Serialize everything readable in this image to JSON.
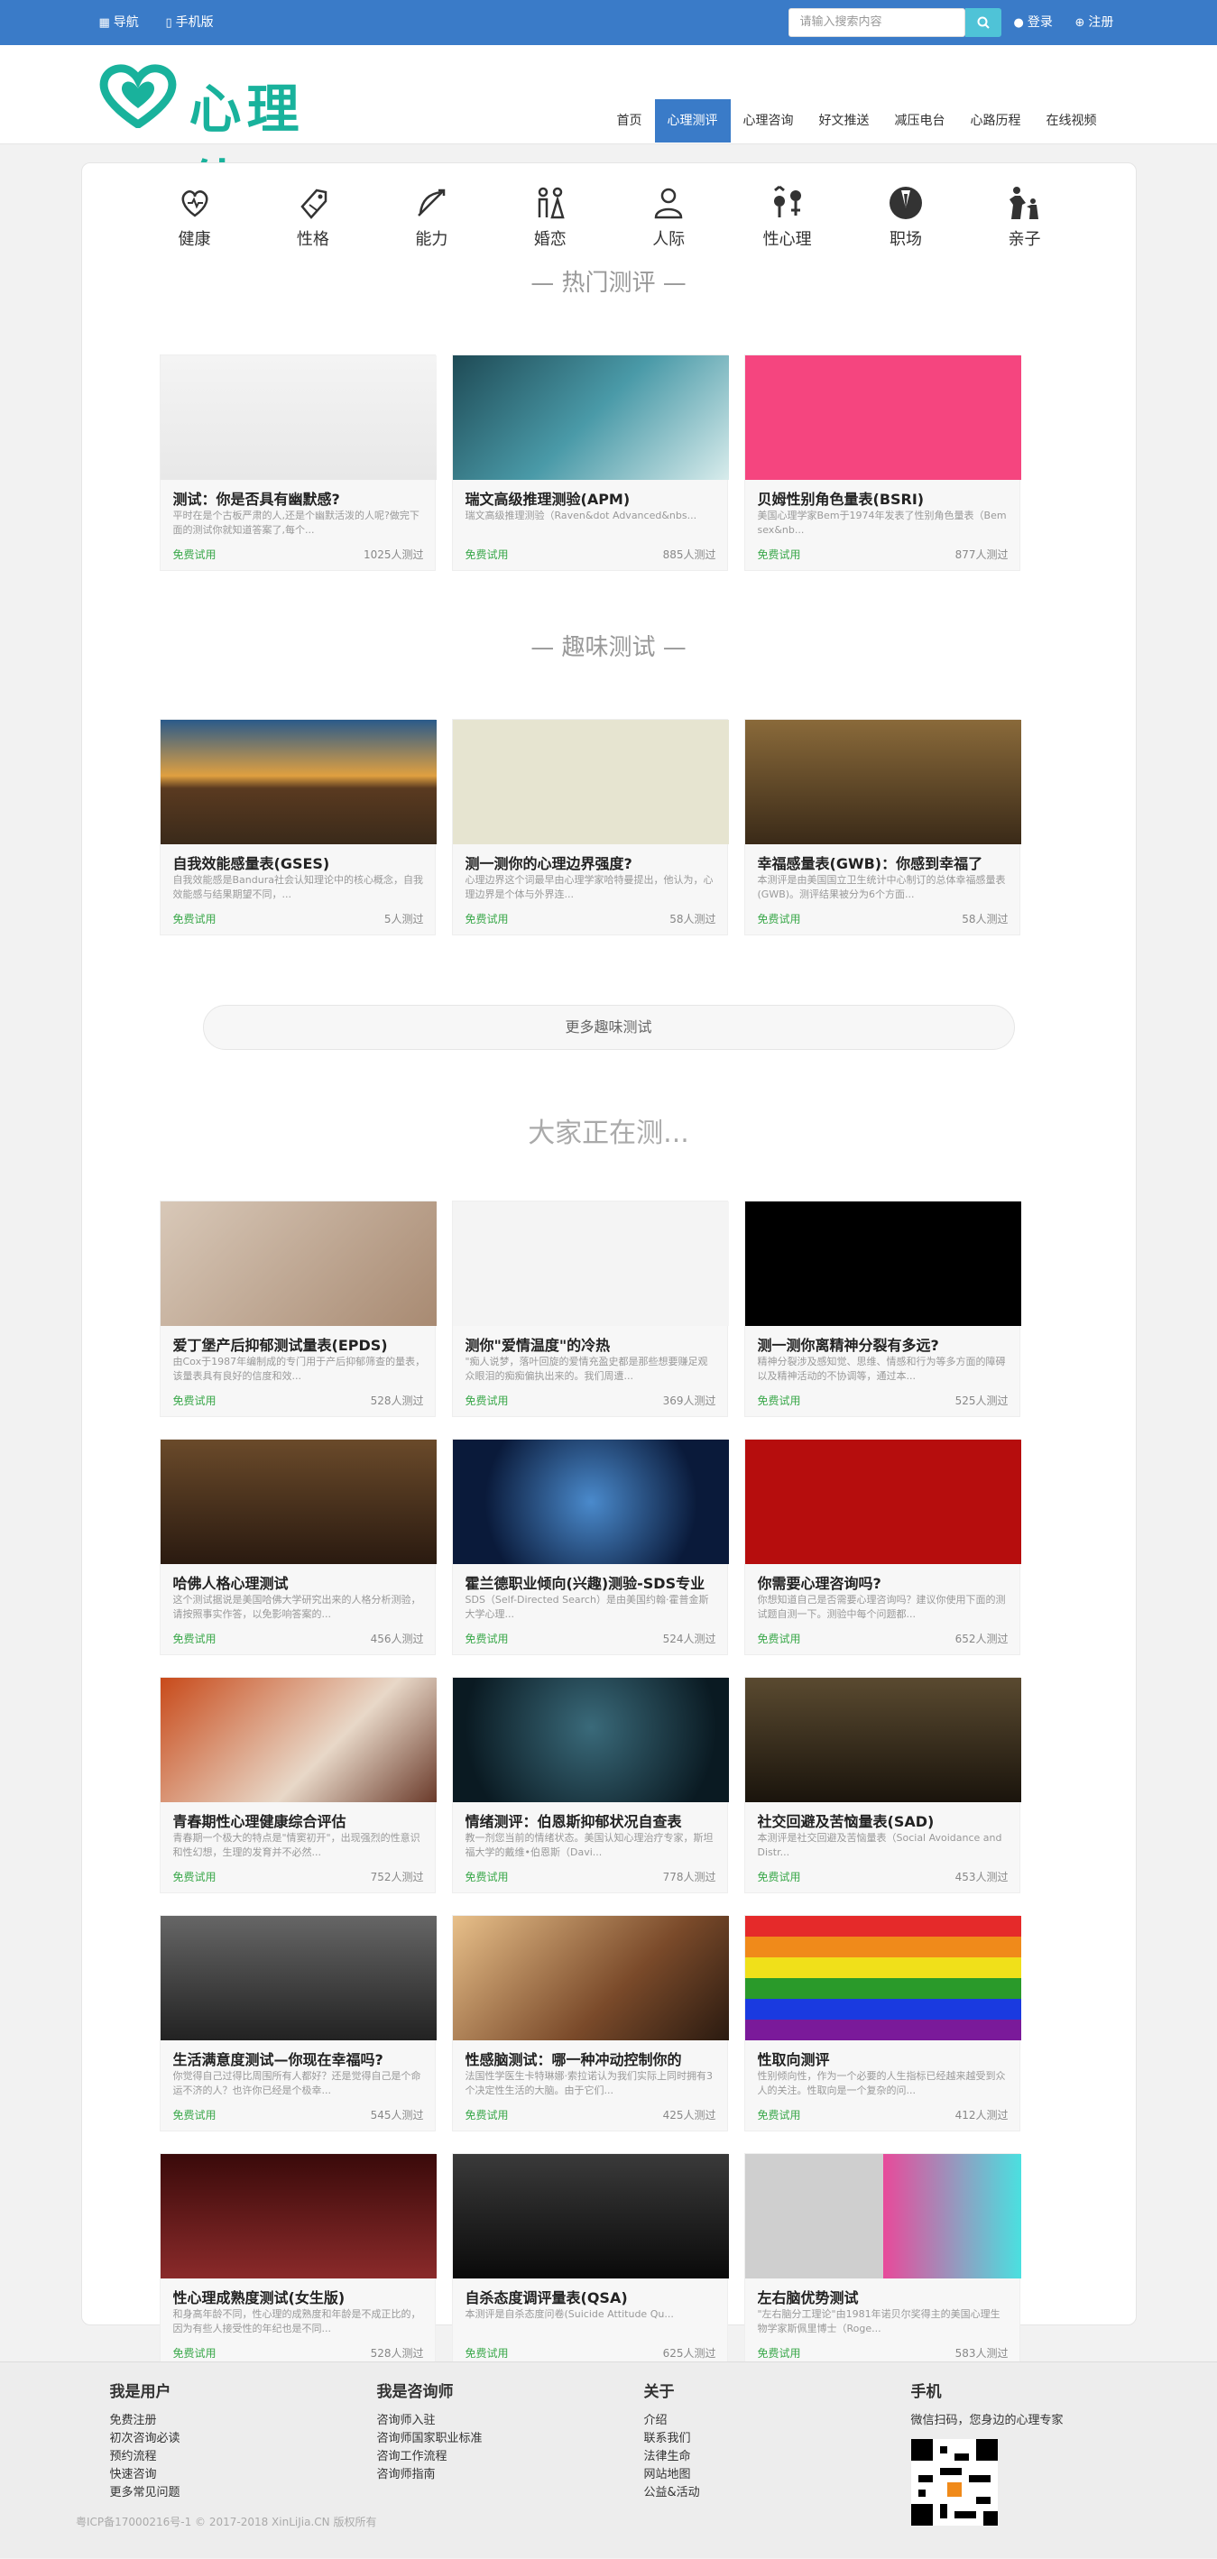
{
  "topbar": {
    "nav_label": "导航",
    "mobile_label": "手机版",
    "search_placeholder": "请输入搜索内容",
    "login_label": "登录",
    "register_label": "注册"
  },
  "header": {
    "logo_text": "心理佳",
    "nav": [
      "首页",
      "心理测评",
      "心理咨询",
      "好文推送",
      "减压电台",
      "心路历程",
      "在线视频"
    ],
    "active_nav": 1
  },
  "categories": [
    "健康",
    "性格",
    "能力",
    "婚恋",
    "人际",
    "性心理",
    "职场",
    "亲子"
  ],
  "hot": {
    "title": "— 热门测评 —",
    "cards": [
      {
        "title": "测试：你是否具有幽默感?",
        "desc": "平时在是个古板严肃的人,还是个幽默活泼的人呢?做完下面的测试你就知道答案了,每个...",
        "free": "免费试用",
        "count": "1025人测过"
      },
      {
        "title": "瑞文高级推理测验(APM)",
        "desc": "瑞文高级推理测验（Raven&dot Advanced&nbs...",
        "free": "免费试用",
        "count": "885人测过"
      },
      {
        "title": "贝姆性别角色量表(BSRI)",
        "desc": "美国心理学家Bem于1974年发表了性别角色量表（Bem sex&nb...",
        "free": "免费试用",
        "count": "877人测过"
      }
    ]
  },
  "fun": {
    "title": "— 趣味测试 —",
    "cards": [
      {
        "title": "自我效能感量表(GSES)",
        "desc": "自我效能感是Bandura社会认知理论中的核心概念，自我效能感与结果期望不同，...",
        "free": "免费试用",
        "count": "5人测过"
      },
      {
        "title": "测一测你的心理边界强度?",
        "desc": "心理边界这个词最早由心理学家哈特曼提出，他认为，心理边界是个体与外界连...",
        "free": "免费试用",
        "count": "58人测过"
      },
      {
        "title": "幸福感量表(GWB)：你感到幸福了",
        "desc": "本测评是由美国国立卫生统计中心制订的总体幸福感量表(GWB)。测评结果被分为6个方面...",
        "free": "免费试用",
        "count": "58人测过"
      }
    ],
    "more_label": "更多趣味测试"
  },
  "popular": {
    "title": "大家正在测...",
    "cards": [
      {
        "title": "爱丁堡产后抑郁测试量表(EPDS)",
        "desc": "由Cox于1987年编制成的专门用于产后抑郁筛查的量表，该量表具有良好的信度和效...",
        "free": "免费试用",
        "count": "528人测过"
      },
      {
        "title": "测你\"爱情温度\"的冷热",
        "desc": "\"痴人说梦，落叶回旋的爱情充盈史都是那些想要赚足观众眼泪的痴痴偏执出来的。我们周遭...",
        "free": "免费试用",
        "count": "369人测过"
      },
      {
        "title": "测一测你离精神分裂有多远?",
        "desc": "精神分裂涉及感知觉、思维、情感和行为等多方面的障碍以及精神活动的不协调等，通过本...",
        "free": "免费试用",
        "count": "525人测过"
      },
      {
        "title": "哈佛人格心理测试",
        "desc": "这个测试据说是美国哈佛大学研究出来的人格分析测验，请按照事实作答，以免影响答案的...",
        "free": "免费试用",
        "count": "456人测过"
      },
      {
        "title": "霍兰德职业倾向(兴趣)测验-SDS专业",
        "desc": "SDS（Self-Directed Search）是由美国约翰·霍普金斯大学心理...",
        "free": "免费试用",
        "count": "524人测过"
      },
      {
        "title": "你需要心理咨询吗?",
        "desc": "你想知道自己是否需要心理咨询吗？建议你使用下面的测试题自测一下。测验中每个问题都...",
        "free": "免费试用",
        "count": "652人测过"
      },
      {
        "title": "青春期性心理健康综合评估",
        "desc": "青春期一个极大的特点是\"情窦初开\"，出现强烈的性意识和性幻想，生理的发育并不必然...",
        "free": "免费试用",
        "count": "752人测过"
      },
      {
        "title": "情绪测评：伯恩斯抑郁状况自查表",
        "desc": "教一剂您当前的情绪状态。美国认知心理治疗专家，斯坦福大学的戴维•伯恩斯（Davi...",
        "free": "免费试用",
        "count": "778人测过"
      },
      {
        "title": "社交回避及苦恼量表(SAD)",
        "desc": "本测评是社交回避及苦恼量表（Social Avoidance and Distr...",
        "free": "免费试用",
        "count": "453人测过"
      },
      {
        "title": "生活满意度测试—你现在幸福吗?",
        "desc": "你觉得自己过得比周围所有人都好？还是觉得自己是个命运不济的人？也许你已经是个极幸...",
        "free": "免费试用",
        "count": "545人测过"
      },
      {
        "title": "性感脑测试：哪一种冲动控制你的",
        "desc": "法国性学医生卡特琳娜·索拉诺认为我们实际上同时拥有3个决定性生活的大脑。由于它们...",
        "free": "免费试用",
        "count": "425人测过"
      },
      {
        "title": "性取向测评",
        "desc": "性别倾向性，作为一个必要的人生指标已经越来越受到众人的关注。性取向是一个复杂的问...",
        "free": "免费试用",
        "count": "412人测过"
      },
      {
        "title": "性心理成熟度测试(女生版)",
        "desc": "和身高年龄不同，性心理的成熟度和年龄是不成正比的，因为有些人接受性的年纪也是不同...",
        "free": "免费试用",
        "count": "528人测过"
      },
      {
        "title": "自杀态度调评量表(QSA)",
        "desc": "本测评是自杀态度问卷(Suicide Attitude Qu...",
        "free": "免费试用",
        "count": "625人测过"
      },
      {
        "title": "左右脑优势测试",
        "desc": "\"左右脑分工理论\"由1981年诺贝尔奖得主的美国心理生物学家斯佩里博士（Roge...",
        "free": "免费试用",
        "count": "583人测过"
      }
    ]
  },
  "footer": {
    "cols": [
      {
        "title": "我是用户",
        "links": [
          "免费注册",
          "初次咨询必读",
          "预约流程",
          "快速咨询",
          "更多常见问题"
        ]
      },
      {
        "title": "我是咨询师",
        "links": [
          "咨询师入驻",
          "咨询师国家职业标准",
          "咨询工作流程",
          "咨询师指南"
        ]
      },
      {
        "title": "关于",
        "links": [
          "介绍",
          "联系我们",
          "法律生命",
          "网站地图",
          "公益&活动"
        ]
      },
      {
        "title": "手机",
        "links": [
          "微信扫码，您身边的心理专家"
        ]
      }
    ],
    "copyright": "粤ICP备17000216号-1 © 2017-2018 XinLiJia.CN 版权所有"
  },
  "colors": {
    "primary": "#3a7bc8",
    "accent": "#19b29c",
    "free": "#3aa84a"
  }
}
